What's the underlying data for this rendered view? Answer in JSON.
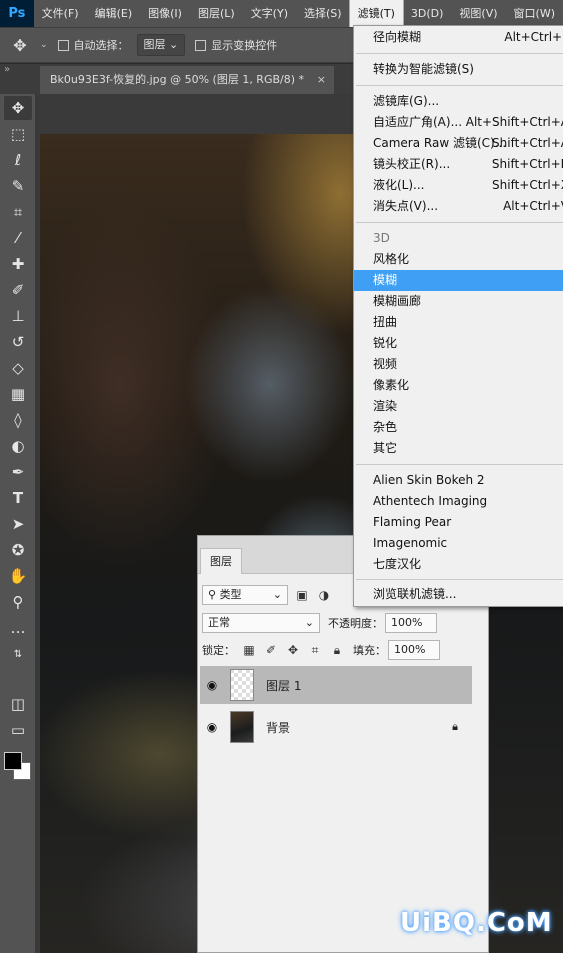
{
  "menubar": {
    "logo": "Ps",
    "items": [
      "文件(F)",
      "编辑(E)",
      "图像(I)",
      "图层(L)",
      "文字(Y)",
      "选择(S)",
      "滤镜(T)",
      "3D(D)",
      "视图(V)",
      "窗口(W)"
    ],
    "active_item": "滤镜(T)"
  },
  "options_bar": {
    "auto_select_label": "自动选择：",
    "auto_select_value": "图层",
    "show_transform_label": "显示变换控件"
  },
  "document_tab": {
    "title": "Bk0u93E3f-恢复的.jpg @ 50% (图层 1, RGB/8) *",
    "close": "×"
  },
  "filter_menu": {
    "items": [
      {
        "label": "径向模糊",
        "shortcut": "Alt+Ctrl+F"
      },
      {
        "label": "转换为智能滤镜(S)",
        "shortcut": ""
      },
      {
        "label": "滤镜库(G)...",
        "shortcut": ""
      },
      {
        "label": "自适应广角(A)...",
        "shortcut": "Alt+Shift+Ctrl+A"
      },
      {
        "label": "Camera Raw 滤镜(C)...",
        "shortcut": "Shift+Ctrl+A"
      },
      {
        "label": "镜头校正(R)...",
        "shortcut": "Shift+Ctrl+R"
      },
      {
        "label": "液化(L)...",
        "shortcut": "Shift+Ctrl+X"
      },
      {
        "label": "消失点(V)...",
        "shortcut": "Alt+Ctrl+V"
      },
      {
        "label": "3D",
        "shortcut": ""
      },
      {
        "label": "风格化",
        "shortcut": ""
      },
      {
        "label": "模糊",
        "shortcut": ""
      },
      {
        "label": "模糊画廊",
        "shortcut": ""
      },
      {
        "label": "扭曲",
        "shortcut": ""
      },
      {
        "label": "锐化",
        "shortcut": ""
      },
      {
        "label": "视频",
        "shortcut": ""
      },
      {
        "label": "像素化",
        "shortcut": ""
      },
      {
        "label": "渲染",
        "shortcut": ""
      },
      {
        "label": "杂色",
        "shortcut": ""
      },
      {
        "label": "其它",
        "shortcut": ""
      },
      {
        "label": "Alien Skin Bokeh 2",
        "shortcut": ""
      },
      {
        "label": "Athentech Imaging",
        "shortcut": ""
      },
      {
        "label": "Flaming Pear",
        "shortcut": ""
      },
      {
        "label": "Imagenomic",
        "shortcut": ""
      },
      {
        "label": "七度汉化",
        "shortcut": ""
      },
      {
        "label": "浏览联机滤镜...",
        "shortcut": ""
      }
    ],
    "highlighted": "模糊"
  },
  "layers_panel": {
    "tab": "图层",
    "filter_type": "类型",
    "blend_mode": "正常",
    "opacity_label": "不透明度：",
    "opacity_value": "100%",
    "lock_label": "锁定：",
    "fill_label": "填充：",
    "fill_value": "100%",
    "layers": [
      {
        "name": "图层 1",
        "selected": true,
        "locked": false
      },
      {
        "name": "背景",
        "selected": false,
        "locked": true
      }
    ]
  },
  "watermark": "UiBQ.CoM",
  "accent_color": "#3e9ff5"
}
